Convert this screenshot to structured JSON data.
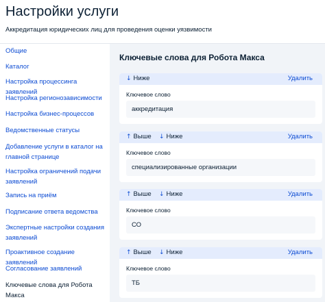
{
  "page": {
    "title": "Настройки услуги",
    "subtitle": "Аккредитация юридических лиц для проведения оценки уязвимости"
  },
  "sidebar": {
    "items": [
      {
        "label": "Общие"
      },
      {
        "label": "Каталог"
      },
      {
        "label": "Настройка процессинга заявлений"
      },
      {
        "label": "Настройка регионозависимости"
      },
      {
        "label": "Настройка бизнес-процессов"
      },
      {
        "label": "Ведомственные статусы"
      },
      {
        "label": "Добавление услуги в каталог на главной странице"
      },
      {
        "label": "Настройка ограничений подачи заявлений"
      },
      {
        "label": "Запись на приём"
      },
      {
        "label": "Подписание ответа ведомства"
      },
      {
        "label": "Экспертные настройки создания заявлений"
      },
      {
        "label": "Проактивное создание заявлений"
      },
      {
        "label": "Согласование заявлений"
      },
      {
        "label": "Ключевые слова для Робота Макса"
      }
    ]
  },
  "main": {
    "section_title": "Ключевые слова для Робота Макса",
    "up_label": "Выше",
    "down_label": "Ниже",
    "delete_label": "Удалить",
    "up_arrow": "↑",
    "down_arrow": "↓",
    "keywords": [
      {
        "label": "Ключевое слово",
        "value": "аккредитация"
      },
      {
        "label": "Ключевое слово",
        "value": "специализированные организации"
      },
      {
        "label": "Ключевое слово",
        "value": "СО"
      },
      {
        "label": "Ключевое слово",
        "value": "ТБ"
      }
    ]
  }
}
